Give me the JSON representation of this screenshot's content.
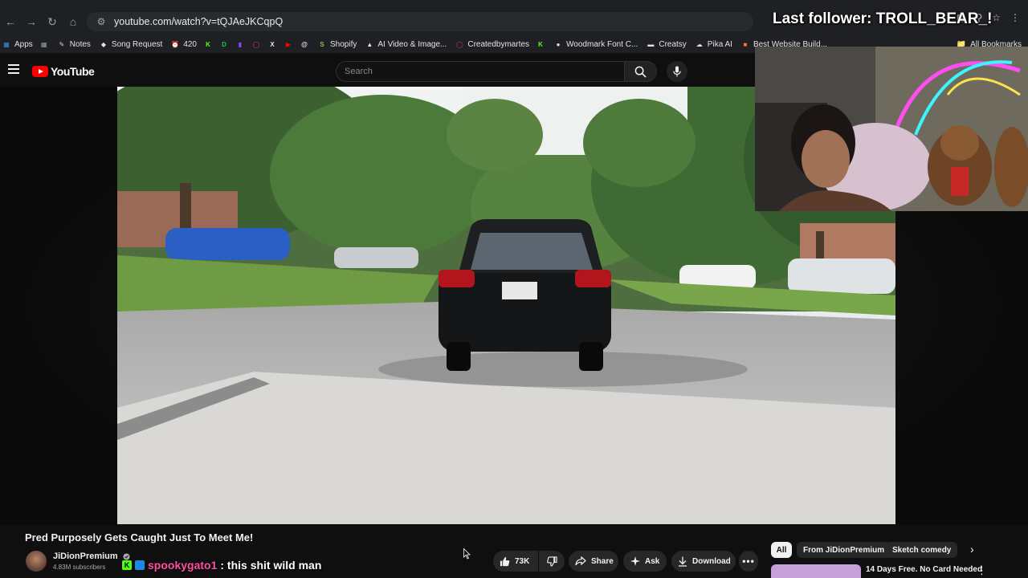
{
  "browser": {
    "url": "youtube.com/watch?v=tQJAeJKCqpQ",
    "bookmarks": [
      {
        "label": "Apps",
        "icon": "apps-grid-icon",
        "color": "#4285f4"
      },
      {
        "label": "",
        "icon": "grid-icon",
        "color": "#9aa0a6"
      },
      {
        "label": "Notes",
        "icon": "notes-icon",
        "color": "#d0d0d0"
      },
      {
        "label": "Song Request",
        "icon": "diamond-icon",
        "color": "#e3e3e3"
      },
      {
        "label": "420",
        "icon": "alarm-icon",
        "color": "#2ecc71"
      },
      {
        "label": "",
        "icon": "kick-icon",
        "color": "#53fc18"
      },
      {
        "label": "",
        "icon": "d-icon",
        "color": "#27c24c"
      },
      {
        "label": "",
        "icon": "twitch-icon",
        "color": "#9146ff"
      },
      {
        "label": "",
        "icon": "instagram-icon",
        "color": "#e1306c"
      },
      {
        "label": "",
        "icon": "x-icon",
        "color": "#e3e3e3"
      },
      {
        "label": "",
        "icon": "youtube-icon",
        "color": "#ff0000"
      },
      {
        "label": "",
        "icon": "threads-icon",
        "color": "#e3e3e3"
      },
      {
        "label": "Shopify",
        "icon": "shopify-icon",
        "color": "#95bf47"
      },
      {
        "label": "AI Video & Image...",
        "icon": "ai-icon",
        "color": "#e3e3e3"
      },
      {
        "label": "Createdbymartes",
        "icon": "instagram-icon",
        "color": "#e1306c"
      },
      {
        "label": "",
        "icon": "kick-icon",
        "color": "#53fc18"
      },
      {
        "label": "Woodmark Font C...",
        "icon": "woodmark-icon",
        "color": "#e3e3e3"
      },
      {
        "label": "Creatsy",
        "icon": "creatsy-icon",
        "color": "#e3e3e3"
      },
      {
        "label": "Pika AI",
        "icon": "pika-icon",
        "color": "#e3e3e3"
      },
      {
        "label": "Best Website Build...",
        "icon": "website-icon",
        "color": "#ff7043"
      }
    ],
    "all_bookmarks": "All Bookmarks"
  },
  "youtube": {
    "logo": "YouTube",
    "search_placeholder": "Search"
  },
  "overlay": {
    "last_follower": "Last follower: TROLL_BEAR_!"
  },
  "video": {
    "title": "Pred Purposely Gets Caught Just To Meet Me!",
    "channel": "JiDionPremium",
    "subscribers": "4.83M subscribers",
    "likes": "73K",
    "share": "Share",
    "ask": "Ask",
    "download": "Download"
  },
  "chat": {
    "user": "spookygato1",
    "message": ": this shit wild man"
  },
  "chips": [
    "All",
    "From JiDionPremium",
    "Sketch comedy"
  ],
  "promo": "14 Days Free. No Card Needed",
  "colors": {
    "yt_red": "#ff0000",
    "bg": "#0f0f0f",
    "chat_user": "#ff4fa0"
  }
}
